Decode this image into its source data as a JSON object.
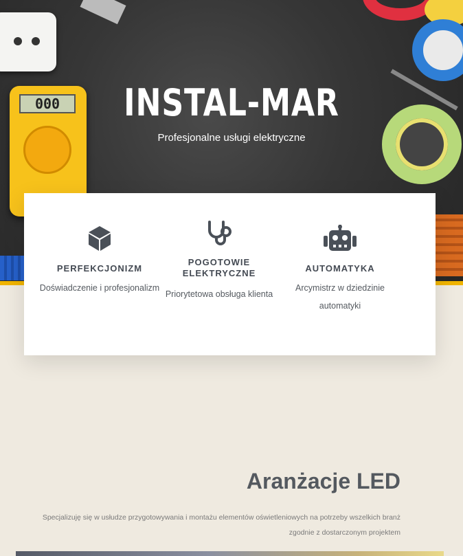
{
  "hero": {
    "title": "INSTAL-MAR",
    "subtitle": "Profesjonalne usługi elektryczne",
    "meter_display": "000"
  },
  "features": [
    {
      "icon": "cube-icon",
      "title": "PERFEKCJONIZM",
      "description": "Doświadczenie i profesjonalizm"
    },
    {
      "icon": "stethoscope-icon",
      "title": "POGOTOWIE ELEKTRYCZNE",
      "description": "Priorytetowa obsługa klienta"
    },
    {
      "icon": "robot-icon",
      "title": "AUTOMATYKA",
      "description": "Arcymistrz w dziedzinie automatyki"
    }
  ],
  "led_section": {
    "title": "Aranżacje LED",
    "description": "Specjalizuję się w usłudze przygotowywania i montażu elementów oświetleniowych na potrzeby wszelkich branż zgodnie z dostarczonym projektem"
  },
  "colors": {
    "accent": "#f0b400",
    "text": "#54595f",
    "background": "#efeae0",
    "icon": "#4a5058"
  }
}
